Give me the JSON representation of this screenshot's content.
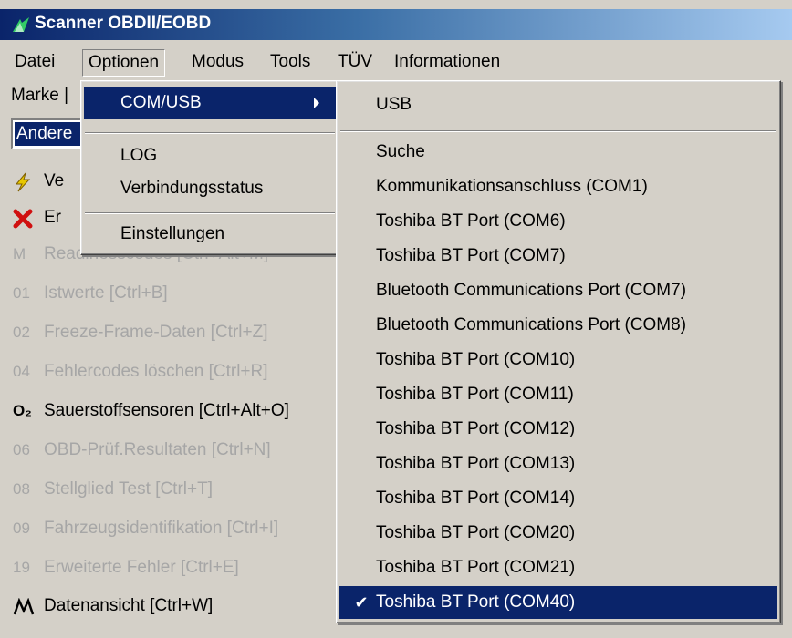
{
  "window": {
    "title": "Scanner OBDII/EOBD"
  },
  "menubar": [
    "Datei",
    "Optionen",
    "Modus",
    "Tools",
    "TÜV",
    "Informationen"
  ],
  "toolbar": {
    "marke_label": "Marke |",
    "combo_value": "Andere"
  },
  "sidebar": [
    {
      "icon": "lightning-icon",
      "label": "Ve"
    },
    {
      "icon": "red-x-icon",
      "label": "Er"
    },
    {
      "icon": "M",
      "label": "Readinesscodes [Ctrl+Alt+M]"
    },
    {
      "icon": "01",
      "label": "Istwerte [Ctrl+B]"
    },
    {
      "icon": "02",
      "label": "Freeze-Frame-Daten [Ctrl+Z]"
    },
    {
      "icon": "04",
      "label": "Fehlercodes löschen [Ctrl+R]"
    },
    {
      "icon": "O₂",
      "label": "Sauerstoffsensoren [Ctrl+Alt+O]"
    },
    {
      "icon": "06",
      "label": "OBD-Prüf.Resultaten [Ctrl+N]"
    },
    {
      "icon": "08",
      "label": "Stellglied Test [Ctrl+T]"
    },
    {
      "icon": "09",
      "label": "Fahrzeugsidentifikation [Ctrl+I]"
    },
    {
      "icon": "19",
      "label": "Erweiterte Fehler [Ctrl+E]"
    },
    {
      "icon": "M-graph-icon",
      "label": "Datenansicht [Ctrl+W]"
    }
  ],
  "optionen_menu": {
    "com_usb": "COM/USB",
    "log": "LOG",
    "verbindungsstatus": "Verbindungsstatus",
    "einstellungen": "Einstellungen"
  },
  "com_menu": {
    "usb": "USB",
    "ports": [
      "Suche",
      "Kommunikationsanschluss (COM1)",
      "Toshiba BT Port (COM6)",
      "Toshiba BT Port (COM7)",
      "Bluetooth Communications Port (COM7)",
      "Bluetooth Communications Port (COM8)",
      "Toshiba BT Port (COM10)",
      "Toshiba BT Port (COM11)",
      "Toshiba BT Port (COM12)",
      "Toshiba BT Port (COM13)",
      "Toshiba BT Port (COM14)",
      "Toshiba BT Port (COM20)",
      "Toshiba BT Port (COM21)",
      "Toshiba BT Port (COM40)"
    ],
    "checked": "Toshiba BT Port (COM40)",
    "check_glyph": "✔"
  }
}
